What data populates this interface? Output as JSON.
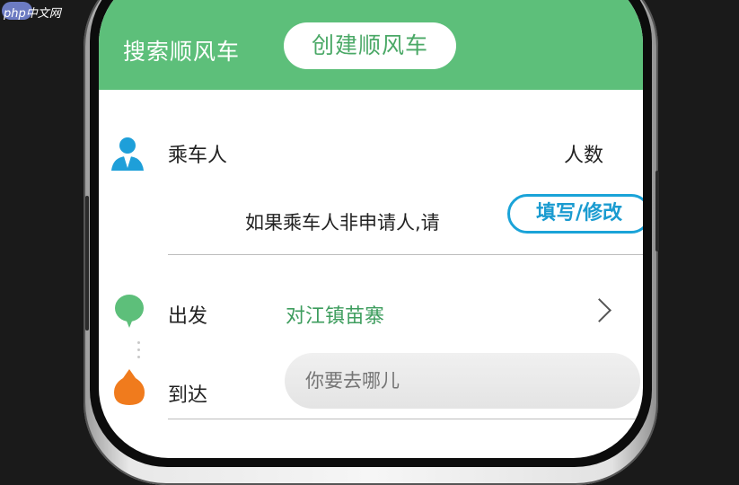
{
  "watermark": "php中文网",
  "header": {
    "tab_search": "搜索顺风车",
    "tab_create": "创建顺风车"
  },
  "passenger": {
    "label": "乘车人",
    "count_label": "人数",
    "hint": "如果乘车人非申请人,请",
    "edit_button": "填写/修改"
  },
  "origin": {
    "label": "出发",
    "value": "对江镇苗寨"
  },
  "destination": {
    "label": "到达",
    "placeholder": "你要去哪儿"
  },
  "colors": {
    "header_green": "#5dbf7a",
    "origin_green": "#3e9d5e",
    "destination_orange": "#f07b1d",
    "button_blue": "#1aa3d8",
    "person_icon_blue": "#1e9fd9"
  }
}
